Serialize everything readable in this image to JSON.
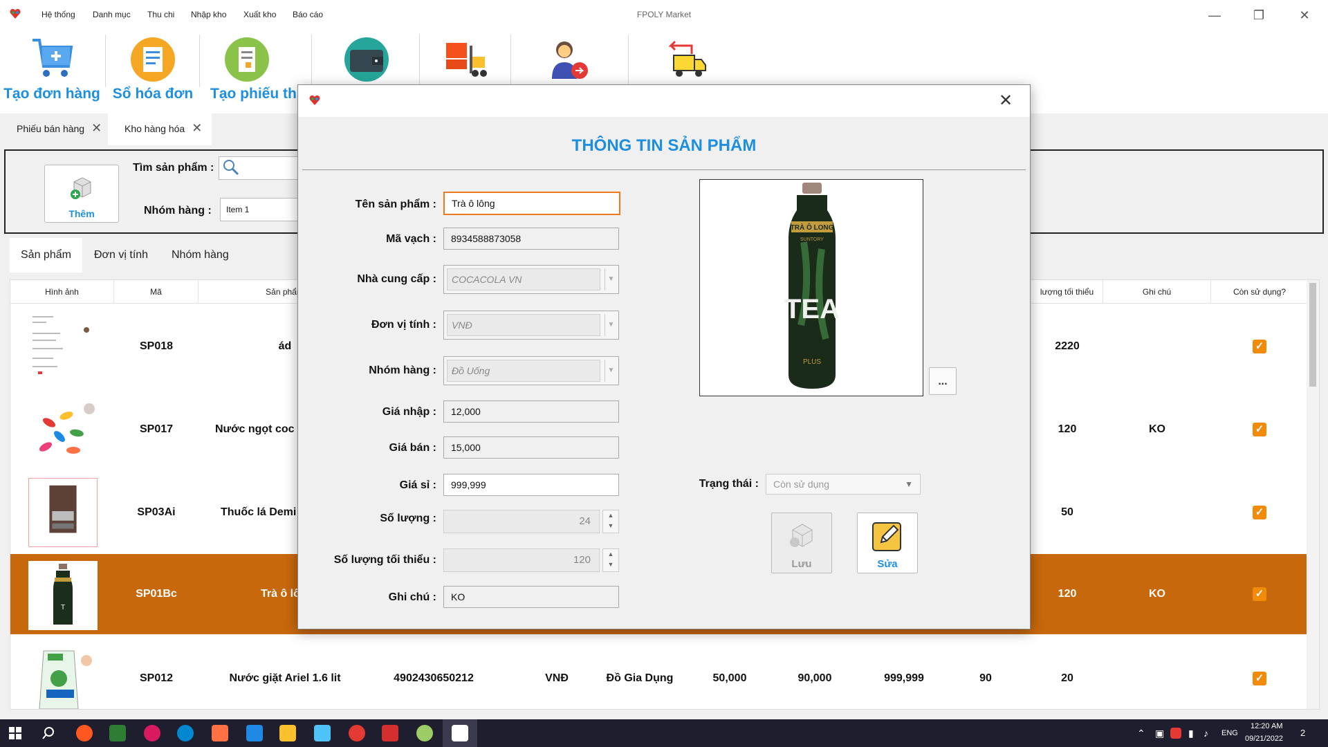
{
  "app": {
    "title": "FPOLY Market",
    "menu": [
      "Hệ thống",
      "Danh mục",
      "Thu chi",
      "Nhập kho",
      "Xuất kho",
      "Báo cáo"
    ]
  },
  "toolbar": {
    "items": [
      {
        "label": "Tạo đơn hàng",
        "icon": "cart-icon"
      },
      {
        "label": "Sổ hóa đơn",
        "icon": "invoice-book-icon"
      },
      {
        "label": "Tạo phiếu thu",
        "icon": "receipt-icon"
      },
      {
        "label": "",
        "icon": "wallet-icon"
      },
      {
        "label": "",
        "icon": "forklift-icon"
      },
      {
        "label": "",
        "icon": "customer-icon"
      },
      {
        "label": "",
        "icon": "return-truck-icon"
      }
    ]
  },
  "doc_tabs": [
    {
      "label": "Phiếu bán hàng"
    },
    {
      "label": "Kho hàng hóa"
    }
  ],
  "filter": {
    "add_label": "Thêm",
    "search_label": "Tìm sản phẩm :",
    "group_label": "Nhóm hàng :",
    "group_value": "Item 1"
  },
  "sub_tabs": [
    "Sản phẩm",
    "Đơn vị tính",
    "Nhóm hàng"
  ],
  "grid": {
    "headers": [
      "Hình ảnh",
      "Mã",
      "Sản phẩm",
      "lượng tối thiểu",
      "Ghi chú",
      "Còn sử dụng?"
    ],
    "rows": [
      {
        "code": "SP018",
        "name": "ád",
        "min_qty": "2220",
        "note": "",
        "active": true
      },
      {
        "code": "SP017",
        "name": "Nước ngọt coc",
        "min_qty": "120",
        "note": "KO",
        "active": true
      },
      {
        "code": "SP03Ai",
        "name": "Thuốc lá Demi",
        "min_qty": "50",
        "note": "",
        "active": true
      },
      {
        "code": "SP01Bc",
        "name": "Trà ô lô",
        "min_qty": "120",
        "note": "KO",
        "active": true,
        "selected": true
      },
      {
        "code": "SP012",
        "name": "Nước giặt Ariel 1.6 lit",
        "barcode": "4902430650212",
        "unit": "VNĐ",
        "group": "Đồ Gia Dụng",
        "buy": "50,000",
        "sell": "90,000",
        "wholesale": "999,999",
        "qty": "90",
        "min_qty": "20",
        "note": "",
        "active": true
      }
    ]
  },
  "dialog": {
    "title": "THÔNG TIN SẢN PHẨM",
    "fields": {
      "name_label": "Tên sản phẩm :",
      "name_value": "Trà ô lông",
      "barcode_label": "Mã vạch :",
      "barcode_value": "8934588873058",
      "supplier_label": "Nhà cung cấp :",
      "supplier_value": "COCACOLA VN",
      "unit_label": "Đơn vị tính :",
      "unit_value": "VNĐ",
      "group_label": "Nhóm hàng :",
      "group_value": "Đồ Uống",
      "buy_label": "Giá nhập :",
      "buy_value": "12,000",
      "sell_label": "Giá bán :",
      "sell_value": "15,000",
      "wholesale_label": "Giá sỉ :",
      "wholesale_value": "999,999",
      "qty_label": "Số lượng :",
      "qty_value": "24",
      "min_qty_label": "Số lượng tối thiểu :",
      "min_qty_value": "120",
      "note_label": "Ghi chú :",
      "note_value": "KO"
    },
    "browse_label": "...",
    "status_label": "Trạng thái :",
    "status_value": "Còn sử dụng",
    "save_label": "Lưu",
    "edit_label": "Sửa",
    "bottle_top_text": "TRÀ Ô LONG",
    "bottle_brand": "SUNTORY",
    "bottle_main": "TEA",
    "bottle_sub": "PLUS"
  },
  "taskbar": {
    "lang": "ENG",
    "time": "12:20 AM",
    "date": "09/21/2022",
    "notif_count": "2"
  },
  "colors": {
    "accent": "#1e8fe0",
    "selected_row": "#c7680c",
    "checkbox": "#f28a0a",
    "focus_border": "#f0781a"
  }
}
